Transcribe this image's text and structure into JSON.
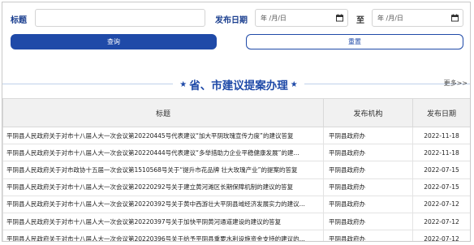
{
  "search": {
    "title_label": "标题",
    "title_value": "",
    "date_label": "发布日期",
    "date_start_placeholder": "年 /月/日",
    "date_sep": "至",
    "date_end_placeholder": "年 /月/日",
    "query_label": "查询",
    "reset_label": "重置"
  },
  "section": {
    "title": "省、市建议提案办理",
    "star": "★",
    "more": "更多>>"
  },
  "table": {
    "headers": {
      "title": "标题",
      "org": "发布机构",
      "date": "发布日期"
    },
    "rows": [
      {
        "title": "平阴县人民政府关于对市十八届人大一次会议第20220445号代表建议“加大平阴玫瑰宣传力度”的建议答复",
        "org": "平阴县政府办",
        "date": "2022-11-18"
      },
      {
        "title": "平阴县人民政府关于对市十八届人大一次会议第20220444号代表建议“多举措助力企业平稳健康发展”的建...",
        "org": "平阴县政府办",
        "date": "2022-11-18"
      },
      {
        "title": "平阴县人民政府关于对市政协十五届一次会议第1510568号关于“提升市花品牌 壮大玫瑰产业”的提案的答复",
        "org": "平阴县政府办",
        "date": "2022-07-15"
      },
      {
        "title": "平阴县人民政府关于对市十八届人大一次会议第20220292号关于建立黄河滩区长期保障机制的建议的答复",
        "org": "平阴县政府办",
        "date": "2022-07-15"
      },
      {
        "title": "平阴县人民政府关于对市十八届人大一次会议第20220392号关于黄中西游壮大平阴县域经济发展实力的建议...",
        "org": "平阴县政府办",
        "date": "2022-07-12"
      },
      {
        "title": "平阴县人民政府关于对市十八届人大一次会议第20220397号关于加快平阴黄河通道建设的建议的答复",
        "org": "平阴县政府办",
        "date": "2022-07-12"
      },
      {
        "title": "平阴县人民政府关于对市十八届人大一次会议第20220396号关于给予平阴县重要水利设施资金支持的建议的...",
        "org": "平阴县政府办",
        "date": "2022-07-12"
      }
    ]
  }
}
